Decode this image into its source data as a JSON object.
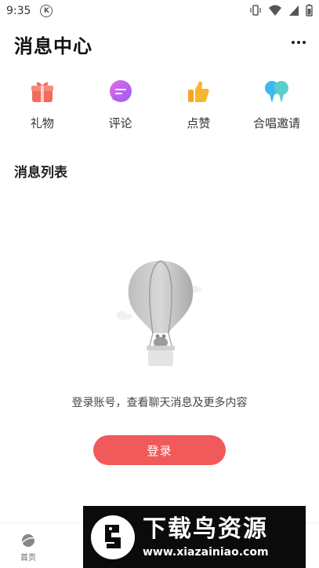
{
  "status_bar": {
    "time": "9:35",
    "k_icon_letter": "K",
    "icons": [
      "vibrate-icon",
      "wifi-icon",
      "signal-icon",
      "battery-icon"
    ]
  },
  "header": {
    "title": "消息中心",
    "more_icon": "more-dots-icon"
  },
  "categories": [
    {
      "label": "礼物",
      "icon": "gift-icon",
      "color": "#f26b5b"
    },
    {
      "label": "评论",
      "icon": "comment-icon",
      "color": "#c46bf0"
    },
    {
      "label": "点赞",
      "icon": "thumbs-up-icon",
      "color": "#f5a623"
    },
    {
      "label": "合唱邀请",
      "icon": "duet-invite-icon",
      "color": "#3fb8f0"
    }
  ],
  "section": {
    "title": "消息列表"
  },
  "empty_state": {
    "illustration": "hot-air-balloon-icon",
    "message": "登录账号，查看聊天消息及更多内容",
    "login_button": "登录"
  },
  "tabbar": {
    "items": [
      {
        "label": "首页",
        "icon": "home-planet-icon"
      },
      {
        "label": "",
        "icon": "discover-icon"
      },
      {
        "label": "",
        "icon": "center-record-icon"
      },
      {
        "label": "",
        "icon": "message-icon"
      },
      {
        "label": "",
        "icon": "profile-icon"
      }
    ]
  },
  "watermark": {
    "title": "下载鸟资源",
    "url": "www.xiazainiao.com"
  },
  "colors": {
    "accent": "#f05a5a",
    "text_primary": "#111111",
    "text_secondary": "#444444"
  }
}
